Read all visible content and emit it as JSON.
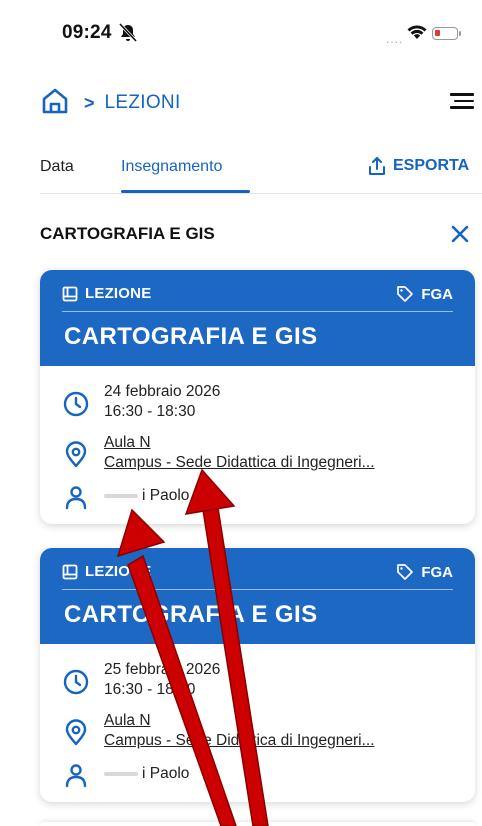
{
  "status_bar": {
    "time": "09:24",
    "signal_dots": "....",
    "icons": [
      "bell-slash-icon",
      "wifi-icon",
      "battery-icon"
    ]
  },
  "breadcrumb": {
    "separator": ">",
    "current": "LEZIONI",
    "icons": [
      "home-icon",
      "menu-icon"
    ]
  },
  "tabs": {
    "items": [
      {
        "label": "Data"
      },
      {
        "label": "Insegnamento",
        "active": true
      }
    ],
    "export_label": "ESPORTA"
  },
  "filter": {
    "title": "CARTOGRAFIA E GIS"
  },
  "cards": [
    {
      "type_label": "LEZIONE",
      "tag": "FGA",
      "title": "CARTOGRAFIA E GIS",
      "date": "24 febbraio 2026",
      "time": "16:30 - 18:30",
      "room": "Aula N",
      "campus": "Campus - Sede Didattica di Ingegneri...",
      "teacher": "i Paolo"
    },
    {
      "type_label": "LEZIONE",
      "tag": "FGA",
      "title": "CARTOGRAFIA E GIS",
      "date": "25 febbraio 2026",
      "time": "16:30 - 18:30",
      "room": "Aula N",
      "campus": "Campus - Sede Didattica di Ingegneri...",
      "teacher": "i Paolo"
    }
  ],
  "colors": {
    "accent": "#1565c0",
    "card_header": "#1d68c3",
    "annotation_arrow": "#cc0000"
  }
}
